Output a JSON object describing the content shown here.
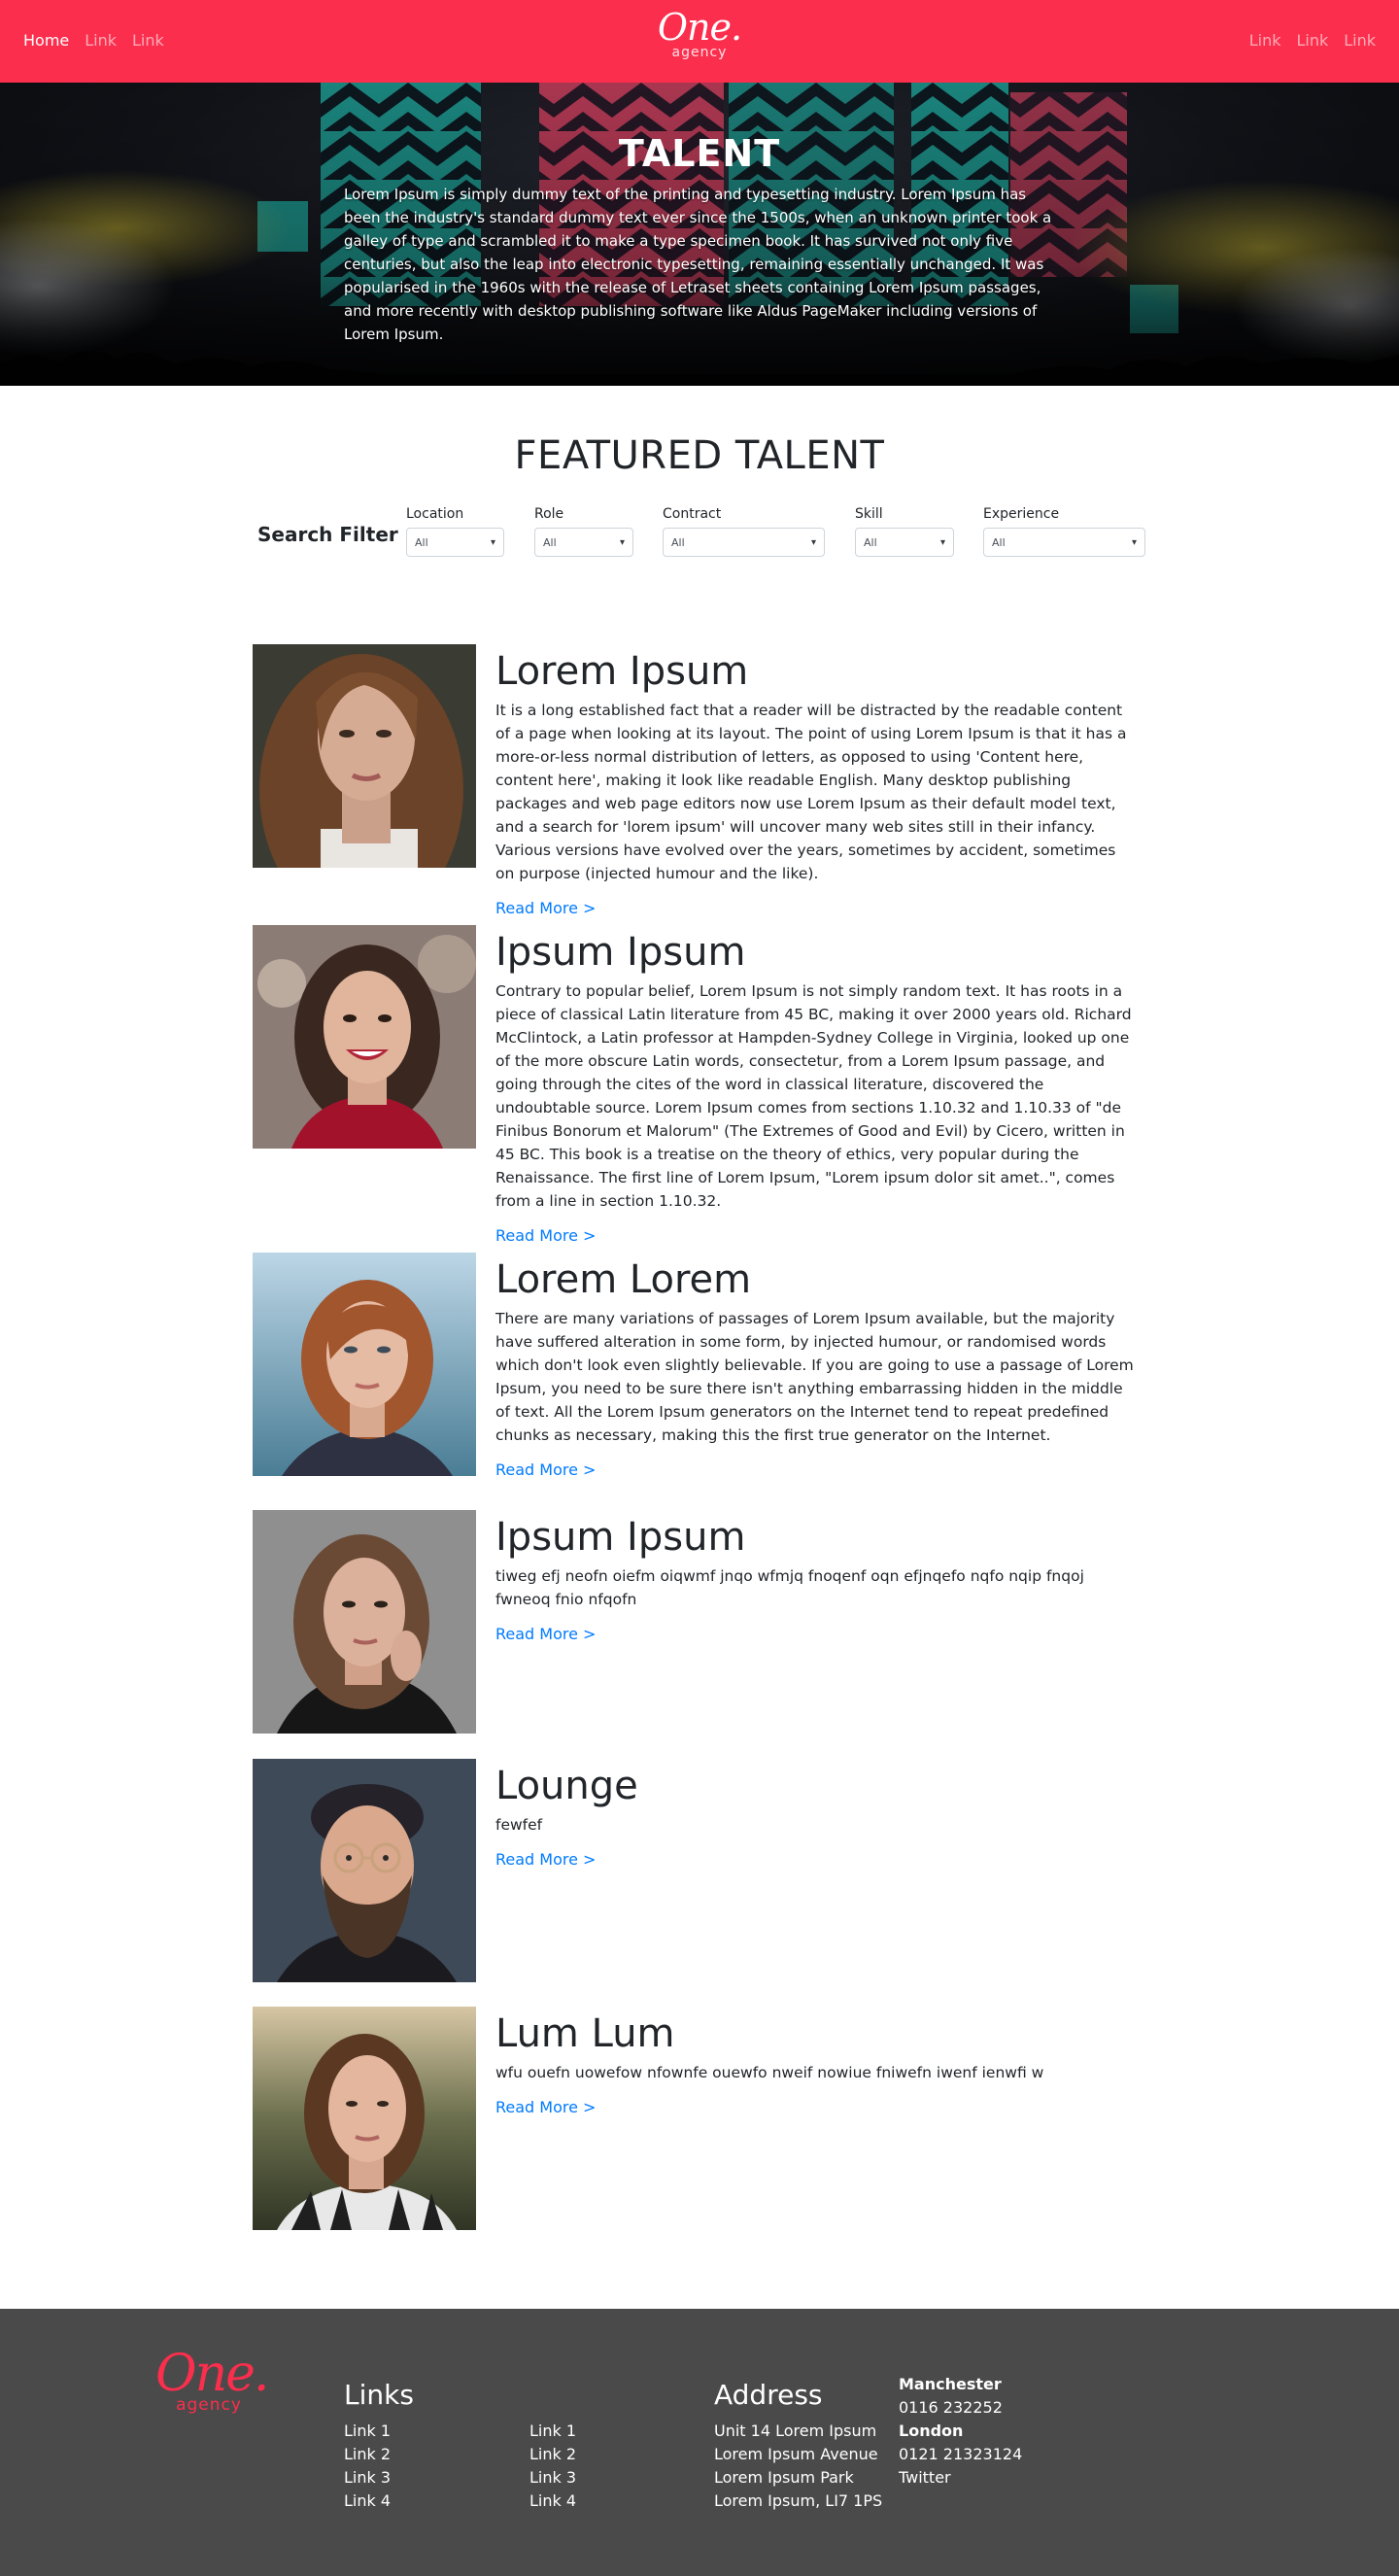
{
  "nav": {
    "left_links": [
      "Home",
      "Link",
      "Link"
    ],
    "right_links": [
      "Link",
      "Link",
      "Link"
    ],
    "brand_script": "One.",
    "brand_sub": "agency",
    "accent_color": "#fc2e4d"
  },
  "hero": {
    "title": "TALENT",
    "text": "Lorem Ipsum is simply dummy text of the printing and typesetting industry. Lorem Ipsum has been the industry's standard dummy text ever since the 1500s, when an unknown printer took a galley of type and scrambled it to make a type specimen book. It has survived not only five centuries, but also the leap into electronic typesetting, remaining essentially unchanged. It was popularised in the 1960s with the release of Letraset sheets containing Lorem Ipsum passages, and more recently with desktop publishing software like Aldus PageMaker including versions of Lorem Ipsum."
  },
  "featured": {
    "heading": "FEATURED TALENT"
  },
  "filters": {
    "title": "Search Filter",
    "items": [
      {
        "label": "Location",
        "value": "All"
      },
      {
        "label": "Role",
        "value": "All"
      },
      {
        "label": "Contract",
        "value": "All"
      },
      {
        "label": "Skill",
        "value": "All"
      },
      {
        "label": "Experience",
        "value": "All"
      }
    ]
  },
  "talents": [
    {
      "name": "Lorem Ipsum",
      "description": "It is a long established fact that a reader will be distracted by the readable content of a page when looking at its layout. The point of using Lorem Ipsum is that it has a more-or-less normal distribution of letters, as opposed to using 'Content here, content here', making it look like readable English. Many desktop publishing packages and web page editors now use Lorem Ipsum as their default model text, and a search for 'lorem ipsum' will uncover many web sites still in their infancy. Various versions have evolved over the years, sometimes by accident, sometimes on purpose (injected humour and the like).",
      "link": "Read More >"
    },
    {
      "name": "Ipsum Ipsum",
      "description": "Contrary to popular belief, Lorem Ipsum is not simply random text. It has roots in a piece of classical Latin literature from 45 BC, making it over 2000 years old. Richard McClintock, a Latin professor at Hampden-Sydney College in Virginia, looked up one of the more obscure Latin words, consectetur, from a Lorem Ipsum passage, and going through the cites of the word in classical literature, discovered the undoubtable source. Lorem Ipsum comes from sections 1.10.32 and 1.10.33 of \"de Finibus Bonorum et Malorum\" (The Extremes of Good and Evil) by Cicero, written in 45 BC. This book is a treatise on the theory of ethics, very popular during the Renaissance. The first line of Lorem Ipsum, \"Lorem ipsum dolor sit amet..\", comes from a line in section 1.10.32.",
      "link": "Read More >"
    },
    {
      "name": "Lorem Lorem",
      "description": "There are many variations of passages of Lorem Ipsum available, but the majority have suffered alteration in some form, by injected humour, or randomised words which don't look even slightly believable. If you are going to use a passage of Lorem Ipsum, you need to be sure there isn't anything embarrassing hidden in the middle of text. All the Lorem Ipsum generators on the Internet tend to repeat predefined chunks as necessary, making this the first true generator on the Internet.",
      "link": "Read More >"
    },
    {
      "name": "Ipsum Ipsum",
      "description": "tiweg efj neofn oiefm oiqwmf jnqo wfmjq fnoqenf oqn efjnqefo nqfo nqip fnqoj fwneoq fnio nfqofn",
      "link": "Read More >"
    },
    {
      "name": "Lounge",
      "description": "fewfef",
      "link": "Read More >"
    },
    {
      "name": "Lum Lum",
      "description": "wfu ouefn uowefow nfownfe ouewfo nweif nowiue fniwefn iwenf ienwfi w",
      "link": "Read More >"
    }
  ],
  "footer": {
    "logo_script": "One.",
    "logo_sub": "agency",
    "links_heading": "Links",
    "links_col1": [
      "Link 1",
      "Link 2",
      "Link 3",
      "Link 4"
    ],
    "links_col2": [
      "Link 1",
      "Link 2",
      "Link 3",
      "Link 4"
    ],
    "address_heading": "Address",
    "address_lines": [
      "Unit 14 Lorem Ipsum",
      "Lorem Ipsum Avenue",
      "Lorem Ipsum Park",
      "Lorem Ipsum, LI7 1PS"
    ],
    "manchester_label": "Manchester",
    "manchester_phone": "0116 232252",
    "london_label": "London",
    "london_phone": "0121 21323124",
    "twitter": "Twitter"
  }
}
